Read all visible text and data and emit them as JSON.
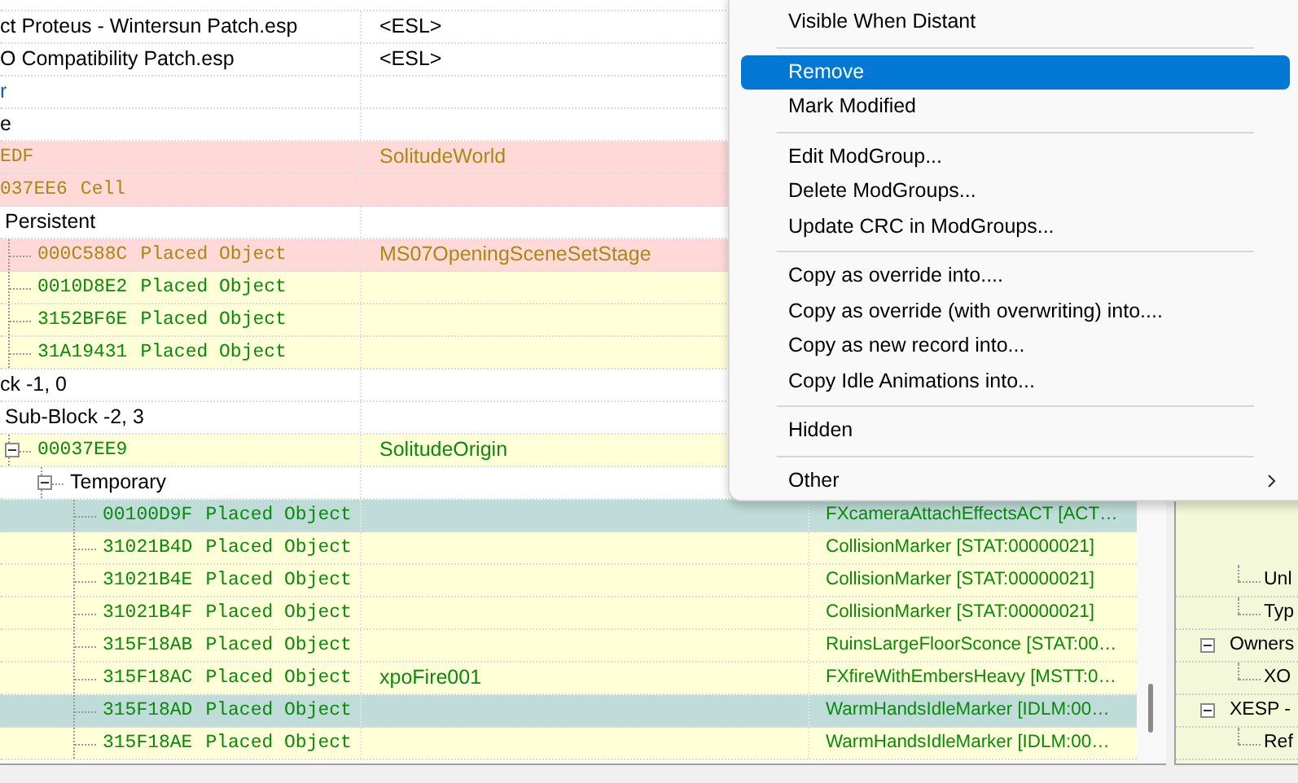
{
  "tree": [
    {
      "label": "ct Proteus - Wintersun Patch.esp",
      "col2": "<ESL>",
      "kind": "plain",
      "selected": false
    },
    {
      "label": "O Compatibility Patch.esp",
      "col2": "<ESL>",
      "kind": "plain",
      "selected": false
    },
    {
      "label": "r",
      "kind": "link",
      "selected": false
    },
    {
      "label": "e",
      "kind": "plain",
      "selected": false
    },
    {
      "form_id": "EDF",
      "col2": "SolitudeWorld",
      "kind": "conflict",
      "selected": false
    },
    {
      "form_id": "037EE6",
      "record_type": "Cell",
      "kind": "conflict",
      "selected": false,
      "children": [
        {
          "label": "Persistent",
          "kind": "plain",
          "selected": false,
          "children": [
            {
              "form_id": "000C588C",
              "record_type": "Placed Object",
              "col2": "MS07OpeningSceneSetStage",
              "kind": "conflict",
              "selected": false
            },
            {
              "form_id": "0010D8E2",
              "record_type": "Placed Object",
              "kind": "override",
              "selected": false
            },
            {
              "form_id": "3152BF6E",
              "record_type": "Placed Object",
              "kind": "override",
              "selected": false
            },
            {
              "form_id": "31A19431",
              "record_type": "Placed Object",
              "kind": "override",
              "selected": false
            }
          ]
        }
      ]
    },
    {
      "label": "ck -1, 0",
      "kind": "plain",
      "selected": false,
      "children": [
        {
          "label": "Sub-Block -2, 3",
          "kind": "plain",
          "selected": false,
          "children": [
            {
              "form_id": "00037EE9",
              "col2": "SolitudeOrigin",
              "kind": "override",
              "selected": false,
              "expanded": true,
              "children": [
                {
                  "label": "Temporary",
                  "kind": "plain",
                  "selected": false,
                  "expanded": true,
                  "children": [
                    {
                      "form_id": "00100D9F",
                      "record_type": "Placed Object",
                      "col3": "FXcameraAttachEffectsACT [ACT…",
                      "kind": "override",
                      "selected": true
                    },
                    {
                      "form_id": "31021B4D",
                      "record_type": "Placed Object",
                      "col3": "CollisionMarker [STAT:00000021]",
                      "kind": "override",
                      "selected": false
                    },
                    {
                      "form_id": "31021B4E",
                      "record_type": "Placed Object",
                      "col3": "CollisionMarker [STAT:00000021]",
                      "kind": "override",
                      "selected": false
                    },
                    {
                      "form_id": "31021B4F",
                      "record_type": "Placed Object",
                      "col3": "CollisionMarker [STAT:00000021]",
                      "kind": "override",
                      "selected": false
                    },
                    {
                      "form_id": "315F18AB",
                      "record_type": "Placed Object",
                      "col3": "RuinsLargeFloorSconce [STAT:00…",
                      "kind": "override",
                      "selected": false
                    },
                    {
                      "form_id": "315F18AC",
                      "record_type": "Placed Object",
                      "col2": "xpoFire001",
                      "col3": "FXfireWithEmbersHeavy [MSTT:0…",
                      "kind": "override",
                      "selected": false
                    },
                    {
                      "form_id": "315F18AD",
                      "record_type": "Placed Object",
                      "col3": "WarmHandsIdleMarker [IDLM:00…",
                      "kind": "override",
                      "selected": true
                    },
                    {
                      "form_id": "315F18AE",
                      "record_type": "Placed Object",
                      "col3": "WarmHandsIdleMarker [IDLM:00…",
                      "kind": "override",
                      "selected": false
                    }
                  ]
                }
              ]
            }
          ]
        }
      ]
    }
  ],
  "details": [
    {
      "label": "Unl",
      "kind": "field"
    },
    {
      "label": "Typ",
      "kind": "field"
    },
    {
      "label": "Owners",
      "kind": "group",
      "expanded": true,
      "children": [
        {
          "label": "XO",
          "kind": "field"
        }
      ]
    },
    {
      "label": "XESP -",
      "kind": "group",
      "expanded": true,
      "children": [
        {
          "label": "Ref",
          "kind": "field"
        }
      ]
    }
  ],
  "context_menu": [
    {
      "kind": "item",
      "label": "Visible When Distant",
      "selected": false
    },
    {
      "kind": "separator"
    },
    {
      "kind": "item",
      "label": "Remove",
      "selected": true
    },
    {
      "kind": "item",
      "label": "Mark Modified",
      "selected": false
    },
    {
      "kind": "separator"
    },
    {
      "kind": "item",
      "label": "Edit ModGroup...",
      "selected": false
    },
    {
      "kind": "item",
      "label": "Delete ModGroups...",
      "selected": false
    },
    {
      "kind": "item",
      "label": "Update CRC in ModGroups...",
      "selected": false
    },
    {
      "kind": "separator"
    },
    {
      "kind": "item",
      "label": "Copy as override into....",
      "selected": false
    },
    {
      "kind": "item",
      "label": "Copy as override (with overwriting) into....",
      "selected": false
    },
    {
      "kind": "item",
      "label": "Copy as new record into...",
      "selected": false
    },
    {
      "kind": "item",
      "label": "Copy Idle Animations into...",
      "selected": false
    },
    {
      "kind": "separator"
    },
    {
      "kind": "item",
      "label": "Hidden",
      "selected": false
    },
    {
      "kind": "separator"
    },
    {
      "kind": "submenu",
      "label": "Other",
      "selected": false
    }
  ]
}
